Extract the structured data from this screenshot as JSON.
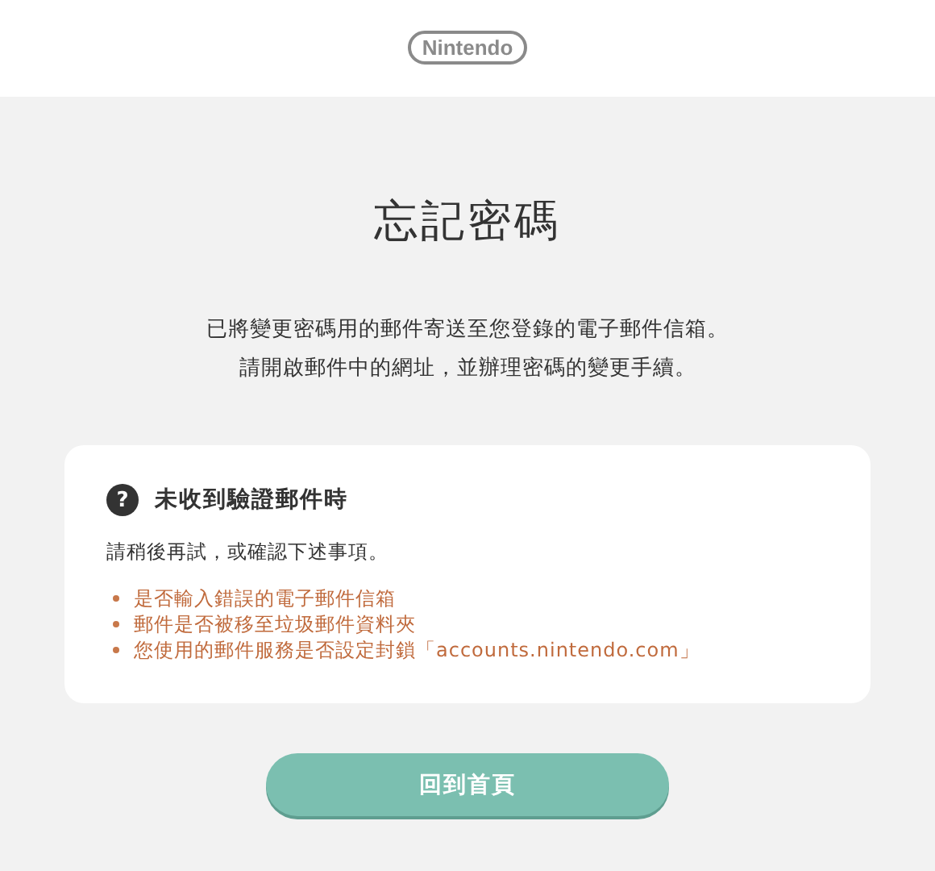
{
  "header": {
    "logo": "Nintendo"
  },
  "title": "忘記密碼",
  "message": [
    "已將變更密碼用的郵件寄送至您登錄的電子郵件信箱。",
    "請開啟郵件中的網址，並辦理密碼的變更手續。"
  ],
  "help_card": {
    "icon": "?",
    "heading": "未收到驗證郵件時",
    "intro": "請稍後再試，或確認下述事項。",
    "items": [
      "是否輸入錯誤的電子郵件信箱",
      "郵件是否被移至垃圾郵件資料夾",
      "您使用的郵件服務是否設定封鎖「accounts.nintendo.com」"
    ]
  },
  "button": "回到首頁"
}
